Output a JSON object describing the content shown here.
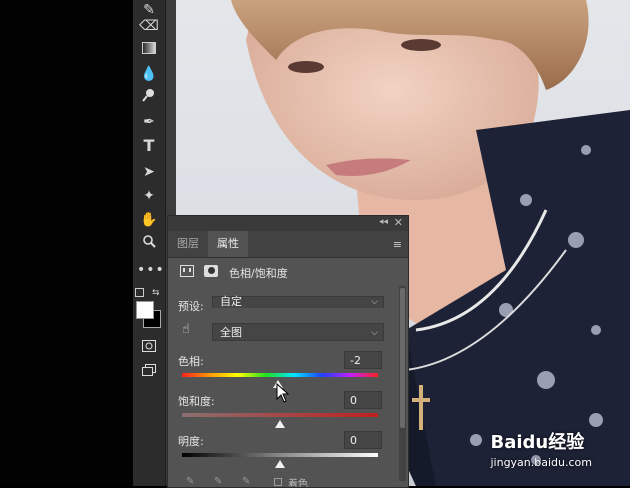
{
  "panel": {
    "tabs": [
      "图层",
      "属性"
    ],
    "active_tab": "属性",
    "adjustment_title": "色相/饱和度",
    "preset_label": "预设:",
    "preset_value": "自定",
    "range_value": "全图",
    "hue_label": "色相:",
    "hue_value": "-2",
    "saturation_label": "饱和度:",
    "saturation_value": "0",
    "lightness_label": "明度:",
    "lightness_value": "0",
    "colorize_label": "着色"
  },
  "watermark": {
    "brand": "Baidu经验",
    "url": "jingyan.baidu.com"
  },
  "colors": {
    "panel_bg": "#535353",
    "toolbar_bg": "#2c2c2c",
    "tab_bg": "#424242"
  }
}
